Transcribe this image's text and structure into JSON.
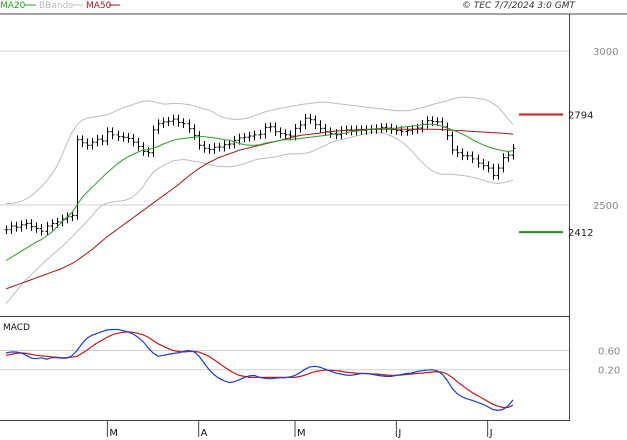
{
  "header": {
    "legend": [
      {
        "label": "MA20",
        "color": "#2a9d2a"
      },
      {
        "label": "BBands",
        "color": "#bdbdbd"
      },
      {
        "label": "MA50",
        "color": "#a01818"
      }
    ],
    "copyright": "© TEC 7/7/2024 3:0 GMT"
  },
  "chart_data": [
    {
      "type": "line",
      "panel": "price",
      "y_ticks": [
        "3000",
        "2500"
      ],
      "ylim": [
        2140,
        3120
      ],
      "x_ticks": [
        "M",
        "A",
        "M",
        "J",
        "J"
      ],
      "x_tick_index": [
        20,
        38,
        57,
        77,
        95
      ],
      "levels": [
        {
          "label": "2794",
          "value": 2794,
          "color": "#d11414"
        },
        {
          "label": "2412",
          "value": 2412,
          "color": "#1c8c1c"
        }
      ],
      "ohlc_close": [
        2420,
        2432,
        2428,
        2436,
        2440,
        2430,
        2424,
        2415,
        2432,
        2440,
        2445,
        2455,
        2462,
        2466,
        2712,
        2702,
        2694,
        2704,
        2714,
        2708,
        2738,
        2728,
        2722,
        2720,
        2716,
        2704,
        2690,
        2674,
        2670,
        2744,
        2764,
        2770,
        2772,
        2779,
        2768,
        2764,
        2748,
        2726,
        2694,
        2684,
        2680,
        2688,
        2688,
        2696,
        2698,
        2710,
        2718,
        2720,
        2724,
        2728,
        2730,
        2752,
        2754,
        2738,
        2732,
        2728,
        2724,
        2749,
        2760,
        2782,
        2777,
        2761,
        2749,
        2738,
        2732,
        2728,
        2742,
        2744,
        2740,
        2744,
        2742,
        2745,
        2746,
        2748,
        2752,
        2750,
        2745,
        2742,
        2739,
        2742,
        2746,
        2750,
        2762,
        2774,
        2771,
        2770,
        2754,
        2725,
        2679,
        2670,
        2660,
        2660,
        2650,
        2636,
        2628,
        2620,
        2596,
        2620,
        2654,
        2662,
        2684
      ],
      "series": [
        {
          "name": "MA20",
          "color": "#2a9d2a",
          "values": [
            2320,
            2330,
            2340,
            2350,
            2360,
            2370,
            2380,
            2388,
            2400,
            2412,
            2428,
            2444,
            2460,
            2476,
            2500,
            2524,
            2542,
            2558,
            2574,
            2590,
            2606,
            2620,
            2634,
            2646,
            2656,
            2664,
            2672,
            2678,
            2680,
            2684,
            2690,
            2698,
            2704,
            2710,
            2714,
            2716,
            2718,
            2720,
            2722,
            2722,
            2720,
            2718,
            2716,
            2712,
            2710,
            2706,
            2700,
            2696,
            2694,
            2694,
            2696,
            2700,
            2704,
            2706,
            2710,
            2712,
            2712,
            2714,
            2716,
            2718,
            2720,
            2722,
            2724,
            2726,
            2728,
            2730,
            2732,
            2734,
            2738,
            2740,
            2742,
            2744,
            2746,
            2748,
            2748,
            2748,
            2748,
            2750,
            2752,
            2754,
            2756,
            2758,
            2760,
            2762,
            2762,
            2760,
            2756,
            2750,
            2744,
            2738,
            2730,
            2722,
            2712,
            2704,
            2696,
            2690,
            2684,
            2680,
            2676,
            2674,
            2676
          ]
        },
        {
          "name": "MA50",
          "color": "#a01818",
          "values": [
            2228,
            2234,
            2240,
            2246,
            2252,
            2258,
            2264,
            2270,
            2276,
            2282,
            2288,
            2294,
            2302,
            2310,
            2320,
            2332,
            2344,
            2356,
            2370,
            2384,
            2398,
            2410,
            2422,
            2434,
            2446,
            2458,
            2470,
            2482,
            2494,
            2506,
            2518,
            2530,
            2542,
            2554,
            2566,
            2580,
            2594,
            2606,
            2618,
            2628,
            2638,
            2646,
            2654,
            2660,
            2666,
            2672,
            2678,
            2682,
            2686,
            2690,
            2694,
            2698,
            2702,
            2706,
            2710,
            2714,
            2718,
            2722,
            2726,
            2728,
            2730,
            2732,
            2734,
            2736,
            2738,
            2740,
            2741,
            2742,
            2743,
            2744,
            2745,
            2746,
            2746,
            2746,
            2746,
            2746,
            2746,
            2746,
            2746,
            2746,
            2746,
            2746,
            2746,
            2746,
            2746,
            2746,
            2745,
            2744,
            2743,
            2742,
            2741,
            2740,
            2739,
            2738,
            2737,
            2736,
            2735,
            2734,
            2733,
            2732,
            2730
          ]
        },
        {
          "name": "BB upper",
          "color": "#bdbdbd",
          "values": [
            2505,
            2505,
            2508,
            2512,
            2520,
            2530,
            2545,
            2560,
            2578,
            2600,
            2625,
            2660,
            2700,
            2735,
            2760,
            2775,
            2782,
            2785,
            2788,
            2790,
            2794,
            2800,
            2808,
            2815,
            2820,
            2826,
            2832,
            2836,
            2838,
            2836,
            2832,
            2828,
            2828,
            2830,
            2830,
            2828,
            2826,
            2822,
            2818,
            2812,
            2808,
            2800,
            2790,
            2784,
            2780,
            2778,
            2778,
            2780,
            2784,
            2790,
            2796,
            2802,
            2806,
            2810,
            2814,
            2816,
            2820,
            2822,
            2826,
            2828,
            2830,
            2832,
            2834,
            2834,
            2832,
            2830,
            2828,
            2826,
            2824,
            2822,
            2820,
            2818,
            2816,
            2814,
            2812,
            2810,
            2808,
            2806,
            2806,
            2806,
            2808,
            2812,
            2816,
            2820,
            2826,
            2830,
            2834,
            2838,
            2844,
            2848,
            2850,
            2850,
            2848,
            2846,
            2844,
            2840,
            2830,
            2820,
            2800,
            2780,
            2762
          ]
        },
        {
          "name": "BB lower",
          "color": "#bdbdbd",
          "values": [
            2180,
            2200,
            2220,
            2240,
            2258,
            2274,
            2290,
            2306,
            2322,
            2336,
            2350,
            2364,
            2380,
            2396,
            2414,
            2430,
            2448,
            2466,
            2486,
            2500,
            2506,
            2510,
            2512,
            2514,
            2518,
            2526,
            2540,
            2560,
            2584,
            2606,
            2618,
            2628,
            2636,
            2644,
            2646,
            2648,
            2646,
            2642,
            2640,
            2636,
            2632,
            2628,
            2626,
            2624,
            2624,
            2626,
            2630,
            2634,
            2640,
            2646,
            2650,
            2652,
            2654,
            2656,
            2660,
            2664,
            2666,
            2666,
            2666,
            2668,
            2672,
            2678,
            2686,
            2694,
            2702,
            2708,
            2712,
            2716,
            2720,
            2724,
            2728,
            2732,
            2736,
            2736,
            2734,
            2730,
            2724,
            2716,
            2706,
            2692,
            2676,
            2658,
            2640,
            2624,
            2612,
            2604,
            2600,
            2600,
            2600,
            2598,
            2596,
            2594,
            2590,
            2586,
            2582,
            2576,
            2572,
            2570,
            2572,
            2576,
            2580
          ]
        }
      ]
    },
    {
      "type": "line",
      "panel": "MACD",
      "title": "MACD",
      "y_ticks": [
        "0.60",
        "0.20"
      ],
      "ylim": [
        -0.85,
        1.3
      ],
      "series": [
        {
          "name": "MACD",
          "color": "#1a3fd0",
          "values": [
            0.55,
            0.57,
            0.57,
            0.55,
            0.5,
            0.44,
            0.43,
            0.45,
            0.42,
            0.45,
            0.45,
            0.44,
            0.44,
            0.49,
            0.6,
            0.74,
            0.86,
            0.92,
            0.96,
            1.0,
            1.03,
            1.04,
            1.04,
            1.02,
            0.99,
            0.95,
            0.88,
            0.79,
            0.66,
            0.55,
            0.48,
            0.5,
            0.52,
            0.54,
            0.55,
            0.58,
            0.6,
            0.58,
            0.49,
            0.35,
            0.21,
            0.1,
            0.02,
            -0.03,
            -0.07,
            -0.05,
            -0.01,
            0.04,
            0.07,
            0.08,
            0.04,
            0.02,
            0.01,
            0.02,
            0.03,
            0.03,
            0.05,
            0.08,
            0.14,
            0.21,
            0.26,
            0.27,
            0.25,
            0.21,
            0.17,
            0.13,
            0.11,
            0.09,
            0.08,
            0.1,
            0.12,
            0.12,
            0.11,
            0.09,
            0.07,
            0.06,
            0.06,
            0.08,
            0.1,
            0.12,
            0.13,
            0.16,
            0.18,
            0.19,
            0.2,
            0.18,
            0.11,
            -0.02,
            -0.19,
            -0.3,
            -0.37,
            -0.41,
            -0.44,
            -0.48,
            -0.52,
            -0.57,
            -0.63,
            -0.65,
            -0.63,
            -0.56,
            -0.43
          ]
        },
        {
          "name": "Signal",
          "color": "#c41a1a",
          "values": [
            0.5,
            0.52,
            0.54,
            0.55,
            0.54,
            0.52,
            0.5,
            0.49,
            0.48,
            0.47,
            0.46,
            0.45,
            0.45,
            0.46,
            0.48,
            0.54,
            0.61,
            0.69,
            0.76,
            0.82,
            0.88,
            0.93,
            0.96,
            0.98,
            0.99,
            0.98,
            0.96,
            0.93,
            0.88,
            0.81,
            0.74,
            0.69,
            0.64,
            0.6,
            0.58,
            0.57,
            0.58,
            0.58,
            0.57,
            0.53,
            0.48,
            0.41,
            0.34,
            0.26,
            0.19,
            0.13,
            0.08,
            0.06,
            0.04,
            0.04,
            0.04,
            0.04,
            0.04,
            0.04,
            0.04,
            0.04,
            0.04,
            0.04,
            0.06,
            0.09,
            0.13,
            0.16,
            0.18,
            0.19,
            0.19,
            0.18,
            0.17,
            0.15,
            0.14,
            0.13,
            0.12,
            0.12,
            0.11,
            0.11,
            0.1,
            0.09,
            0.08,
            0.08,
            0.09,
            0.1,
            0.11,
            0.12,
            0.13,
            0.14,
            0.15,
            0.16,
            0.15,
            0.11,
            0.04,
            -0.05,
            -0.13,
            -0.21,
            -0.28,
            -0.34,
            -0.4,
            -0.46,
            -0.52,
            -0.56,
            -0.59,
            -0.59,
            -0.54
          ]
        }
      ]
    }
  ]
}
